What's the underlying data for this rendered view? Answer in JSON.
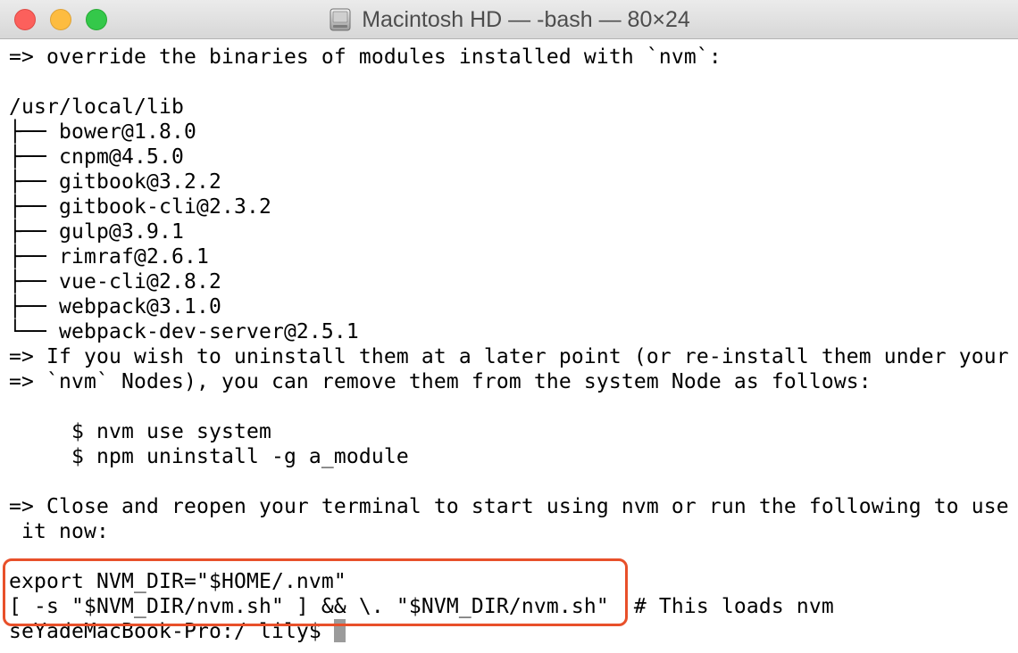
{
  "window": {
    "title": "Macintosh HD — -bash — 80×24",
    "title_icon": "hard-disk-icon",
    "controls": {
      "close_color": "#fc605c",
      "minimize_color": "#fdbc40",
      "zoom_color": "#34c84a"
    }
  },
  "terminal": {
    "lines": [
      "=> override the binaries of modules installed with `nvm`:",
      "",
      "/usr/local/lib",
      "├── bower@1.8.0",
      "├── cnpm@4.5.0",
      "├── gitbook@3.2.2",
      "├── gitbook-cli@2.3.2",
      "├── gulp@3.9.1",
      "├── rimraf@2.6.1",
      "├── vue-cli@2.8.2",
      "├── webpack@3.1.0",
      "└── webpack-dev-server@2.5.1",
      "=> If you wish to uninstall them at a later point (or re-install them under your",
      "=> `nvm` Nodes), you can remove them from the system Node as follows:",
      "",
      "     $ nvm use system",
      "     $ npm uninstall -g a_module",
      "",
      "=> Close and reopen your terminal to start using nvm or run the following to use",
      " it now:",
      "",
      "export NVM_DIR=\"$HOME/.nvm\"",
      "[ -s \"$NVM_DIR/nvm.sh\" ] && \\. \"$NVM_DIR/nvm.sh\"  # This loads nvm"
    ],
    "prompt": "seYadeMacBook-Pro:/ lily$ ",
    "highlight_color": "#e8502a",
    "cursor_color": "#9b9b9b"
  }
}
